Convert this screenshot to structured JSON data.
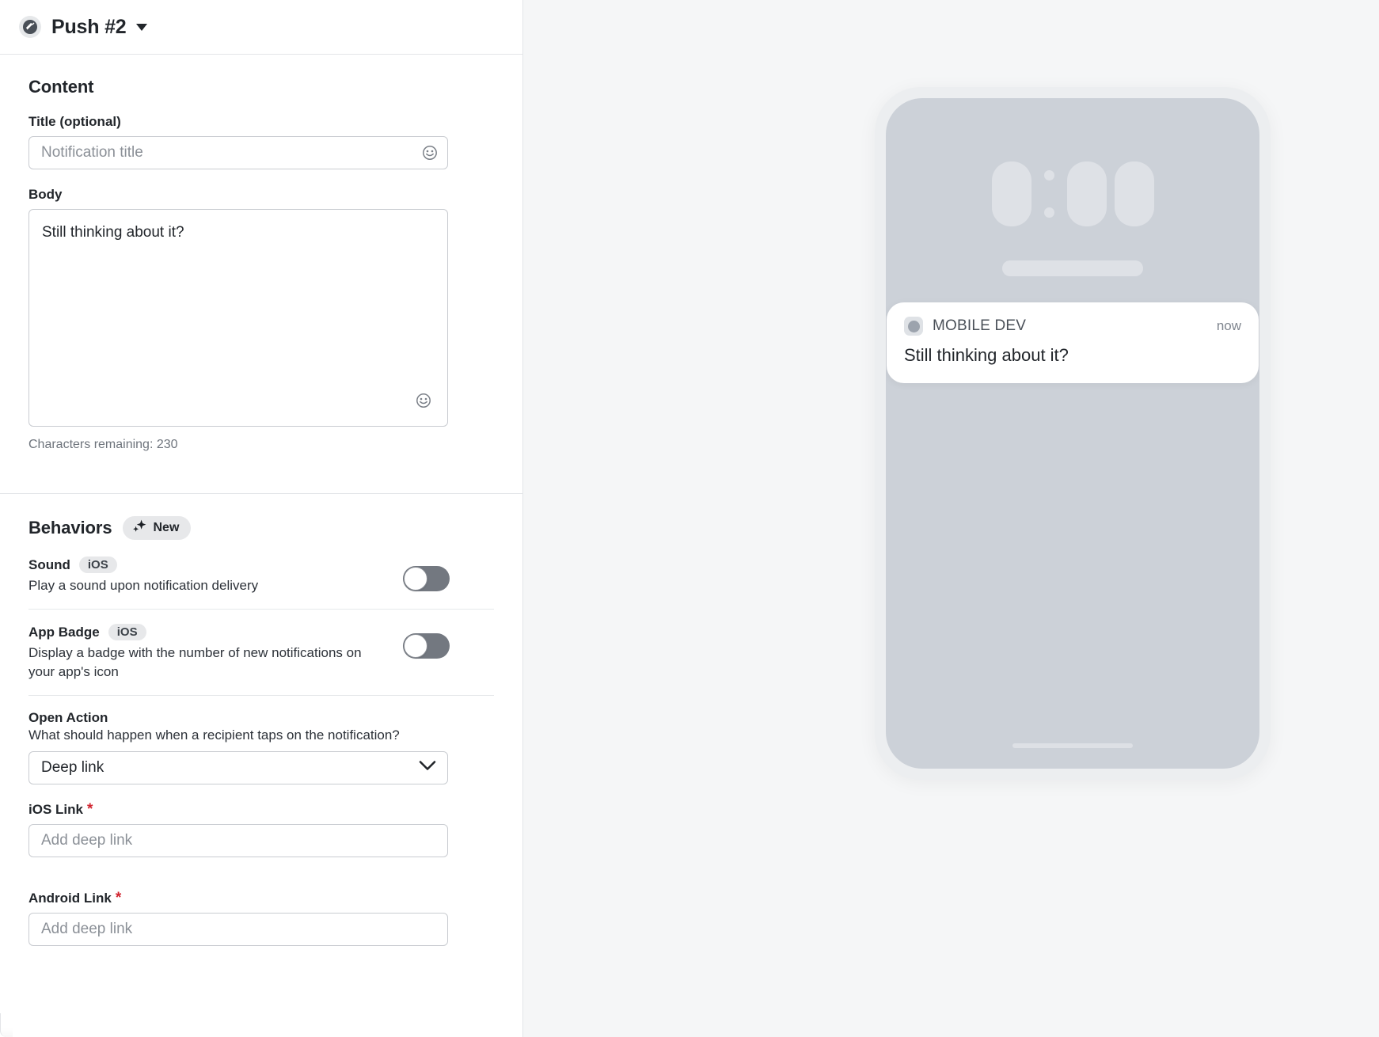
{
  "header": {
    "title": "Push #2",
    "icon": "push-campaign-icon",
    "caret": "chevron-down-icon"
  },
  "content_section": {
    "heading": "Content",
    "title_field": {
      "label": "Title (optional)",
      "placeholder": "Notification title",
      "value": "",
      "emoji_icon": "emoji-smiley-icon"
    },
    "body_field": {
      "label": "Body",
      "value": "Still thinking about it?",
      "emoji_icon": "emoji-smiley-icon",
      "characters_remaining": "Characters remaining: 230"
    }
  },
  "behaviors_section": {
    "heading": "Behaviors",
    "new_badge": {
      "label": "New",
      "icon": "sparkle-icon"
    },
    "rows": [
      {
        "title": "Sound",
        "os_badge": "iOS",
        "description": "Play a sound upon notification delivery",
        "toggle_state": "off"
      },
      {
        "title": "App Badge",
        "os_badge": "iOS",
        "description": "Display a badge with the number of new notifications on your app's icon",
        "toggle_state": "off"
      }
    ],
    "open_action": {
      "label": "Open Action",
      "description": "What should happen when a recipient taps on the notification?",
      "selected": "Deep link",
      "chevron": "chevron-down-icon"
    },
    "ios_link": {
      "label": "iOS Link",
      "required_mark": "*",
      "placeholder": "Add deep link",
      "value": ""
    },
    "android_link": {
      "label": "Android Link",
      "required_mark": "*",
      "placeholder": "Add deep link",
      "value": ""
    }
  },
  "preview": {
    "notification": {
      "app_name": "MOBILE DEV",
      "time": "now",
      "body": "Still thinking about it?"
    }
  },
  "colors": {
    "accent_required": "#d1242f",
    "panel_border": "#e3e5e8",
    "toggle_off_track": "#737880",
    "preview_bg": "#f5f6f7",
    "phone_screen": "#ccd1d8"
  }
}
